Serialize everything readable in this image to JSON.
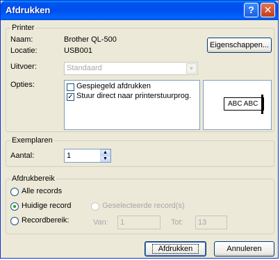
{
  "window": {
    "title": "Afdrukken",
    "help_glyph": "?",
    "close_glyph": "✕"
  },
  "printer": {
    "legend": "Printer",
    "name_label": "Naam:",
    "name_value": "Brother QL-500",
    "location_label": "Locatie:",
    "location_value": "USB001",
    "properties_button": "Eigenschappen...",
    "output_label": "Uitvoer:",
    "output_value": "Standaard",
    "options_label": "Opties:",
    "options": [
      {
        "label": "Gespiegeld afdrukken",
        "checked": false
      },
      {
        "label": "Stuur direct naar printerstuurprog.",
        "checked": true
      }
    ],
    "preview_text": "ABC ABC"
  },
  "copies": {
    "legend": "Exemplaren",
    "count_label": "Aantal:",
    "count_value": "1",
    "up_glyph": "▲",
    "down_glyph": "▼"
  },
  "range": {
    "legend": "Afdrukbereik",
    "all_records": "Alle records",
    "current_record": "Huidige record",
    "selected_records": "Geselecteerde record(s)",
    "record_range": "Recordbereik:",
    "from_label": "Van:",
    "from_value": "1",
    "to_label": "Tot:",
    "to_value": "13",
    "selected": "current_record"
  },
  "buttons": {
    "print": "Afdrukken",
    "cancel": "Annuleren"
  }
}
